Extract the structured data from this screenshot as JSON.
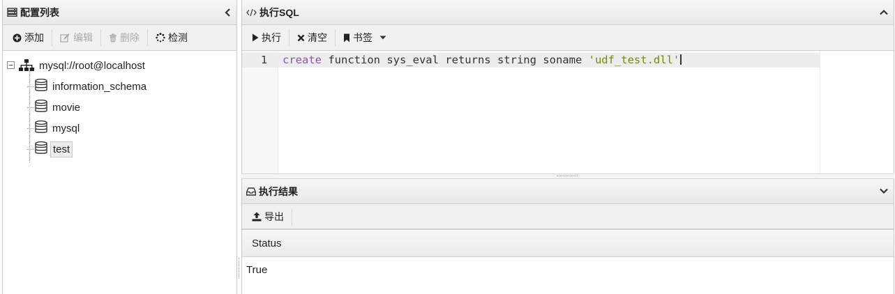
{
  "left_panel": {
    "title": "配置列表",
    "toolbar": {
      "add_label": "添加",
      "edit_label": "编辑",
      "delete_label": "删除",
      "test_label": "检测"
    },
    "tree": {
      "root": "mysql://root@localhost",
      "children": [
        "information_schema",
        "movie",
        "mysql",
        "test"
      ],
      "selected": "test"
    }
  },
  "sql_panel": {
    "title": "执行SQL",
    "toolbar": {
      "run_label": "执行",
      "clear_label": "清空",
      "bookmark_label": "书签"
    },
    "editor": {
      "line_number": "1",
      "tokens": {
        "keyword": "create",
        "rest": " function sys_eval returns string soname ",
        "string": "'udf_test.dll'"
      }
    }
  },
  "result_panel": {
    "title": "执行结果",
    "toolbar": {
      "export_label": "导出"
    },
    "columns": [
      "Status"
    ],
    "rows": [
      [
        "True"
      ]
    ]
  },
  "colors": {
    "keyword": "#8959a8",
    "string": "#718c00"
  },
  "icons": {
    "left_title": "server-list-icon",
    "collapse": "chevron-left-icon",
    "add": "plus-circle-icon",
    "edit": "edit-icon",
    "delete": "trash-icon",
    "test": "spinner-icon",
    "root": "sitemap-icon",
    "database": "database-icon",
    "sql_title": "code-icon",
    "sql_collapse": "chevron-up-icon",
    "run": "play-icon",
    "clear": "close-icon",
    "bookmark": "bookmark-icon",
    "bookmark_dropdown": "caret-down-icon",
    "result_title": "inbox-icon",
    "result_collapse": "chevron-down-icon",
    "export": "upload-icon"
  }
}
